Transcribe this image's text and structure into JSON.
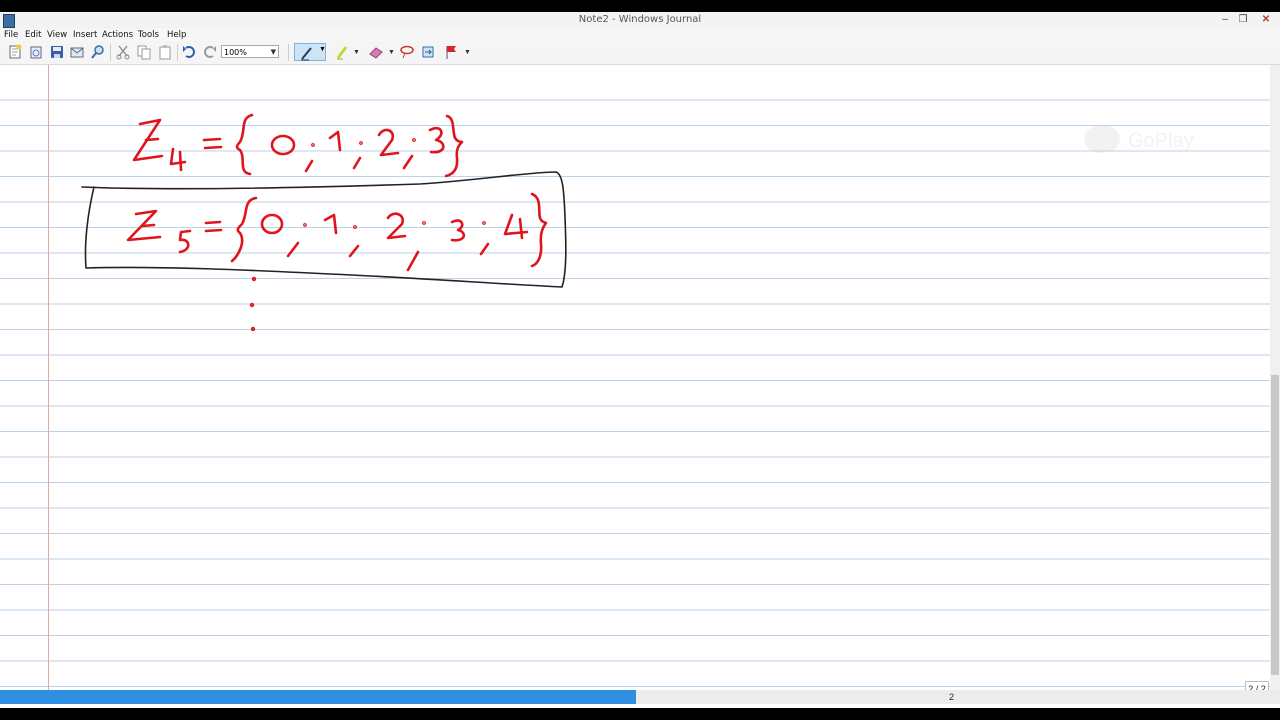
{
  "window": {
    "title": "Note2 - Windows Journal",
    "minimize": "–",
    "restore": "❐",
    "close": "✕"
  },
  "menu": [
    "File",
    "Edit",
    "View",
    "Insert",
    "Actions",
    "Tools",
    "Help"
  ],
  "toolbar": {
    "zoom_value": "100%"
  },
  "page": {
    "indicator": "2 / 2",
    "status_page_number": "2",
    "progress": 0.5
  },
  "note": {
    "line1": "ℤ4 = {0; 1; 2; 3}",
    "line2": "ℤ5 = {0; 1; 2; 3; 4}"
  },
  "colors": {
    "ink_red": "#e0151c",
    "ink_black": "#222222",
    "rule_blue": "#b9d3ea",
    "margin_red": "#e8a3a3",
    "progress_blue": "#2f8fe0"
  }
}
